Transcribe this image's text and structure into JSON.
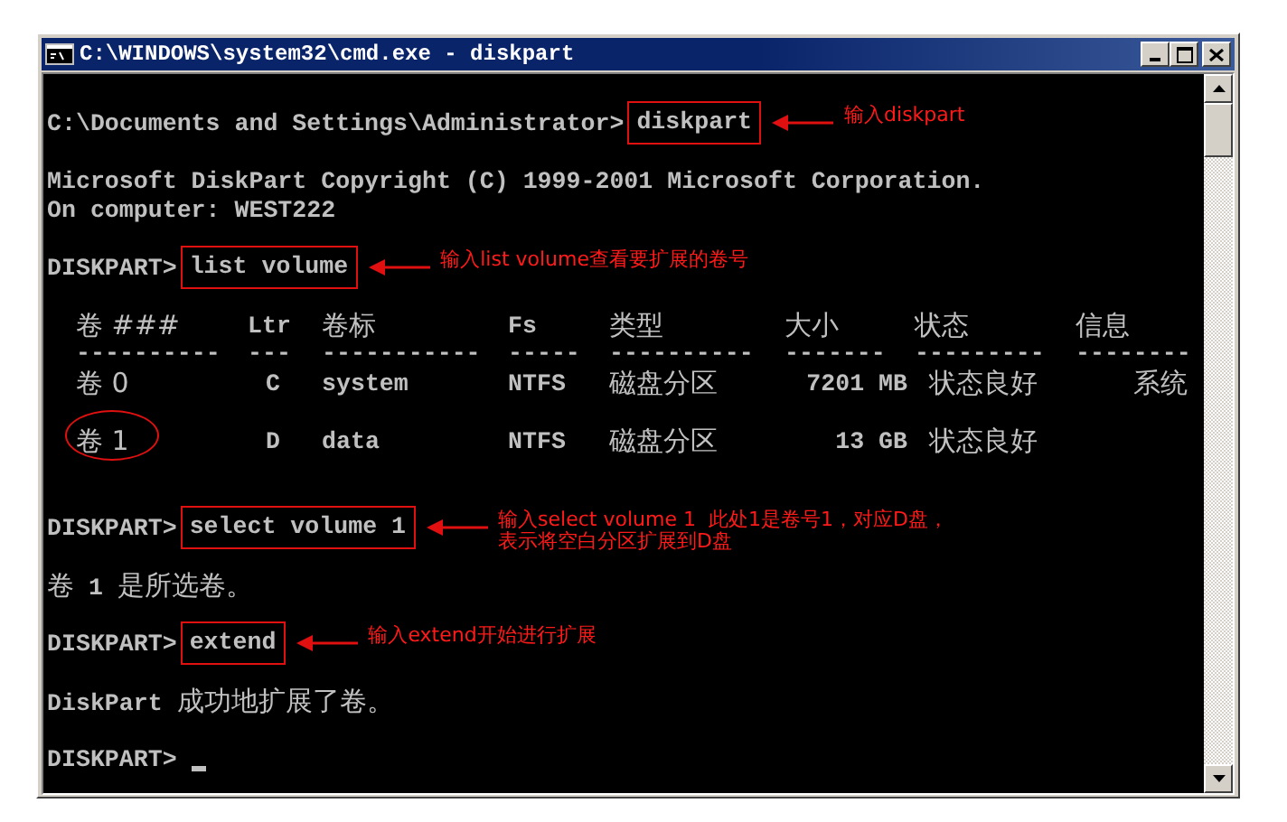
{
  "window": {
    "title": "C:\\WINDOWS\\system32\\cmd.exe - diskpart"
  },
  "console": {
    "lines": [
      {
        "kind": "command",
        "prompt": "C:\\Documents and Settings\\Administrator>",
        "command": "diskpart",
        "note_lines": [
          "输入diskpart"
        ]
      },
      {
        "kind": "output",
        "text": "Microsoft DiskPart Copyright (C) 1999-2001 Microsoft Corporation."
      },
      {
        "kind": "output",
        "text": "On computer: WEST222"
      },
      {
        "kind": "command",
        "prompt": "DISKPART>",
        "command": "list volume",
        "note_lines": [
          "输入list volume查看要扩展的卷号"
        ]
      },
      {
        "kind": "table",
        "columns": [
          {
            "label": "卷 ###",
            "rule": "----------"
          },
          {
            "label": "Ltr",
            "rule": "---"
          },
          {
            "label": "卷标",
            "rule": "-----------"
          },
          {
            "label": "Fs",
            "rule": "-----"
          },
          {
            "label": "类型",
            "rule": "----------"
          },
          {
            "label": "大小",
            "rule": "-------"
          },
          {
            "label": "状态",
            "rule": "---------"
          },
          {
            "label": "信息",
            "rule": "--------"
          }
        ],
        "rows": [
          {
            "cells": [
              "卷 0",
              "C",
              "system",
              "NTFS",
              "磁盘分区",
              "7201 MB",
              "状态良好",
              "系统"
            ],
            "circled": false
          },
          {
            "cells": [
              "卷 1",
              "D",
              "data",
              "NTFS",
              "磁盘分区",
              "13 GB",
              "状态良好"
            ],
            "circled": true
          }
        ]
      },
      {
        "kind": "command",
        "prompt": "DISKPART>",
        "command": "select volume 1",
        "note_lines": [
          "输入select volume 1  此处1是卷号1，对应D盘，",
          "表示将空白分区扩展到D盘"
        ]
      },
      {
        "kind": "output",
        "text": "卷 1 是所选卷。"
      },
      {
        "kind": "command",
        "prompt": "DISKPART>",
        "command": "extend",
        "note_lines": [
          "输入extend开始进行扩展"
        ]
      },
      {
        "kind": "output",
        "text": "DiskPart 成功地扩展了卷。"
      },
      {
        "kind": "prompt",
        "prompt": "DISKPART>",
        "cursor": true
      }
    ]
  }
}
